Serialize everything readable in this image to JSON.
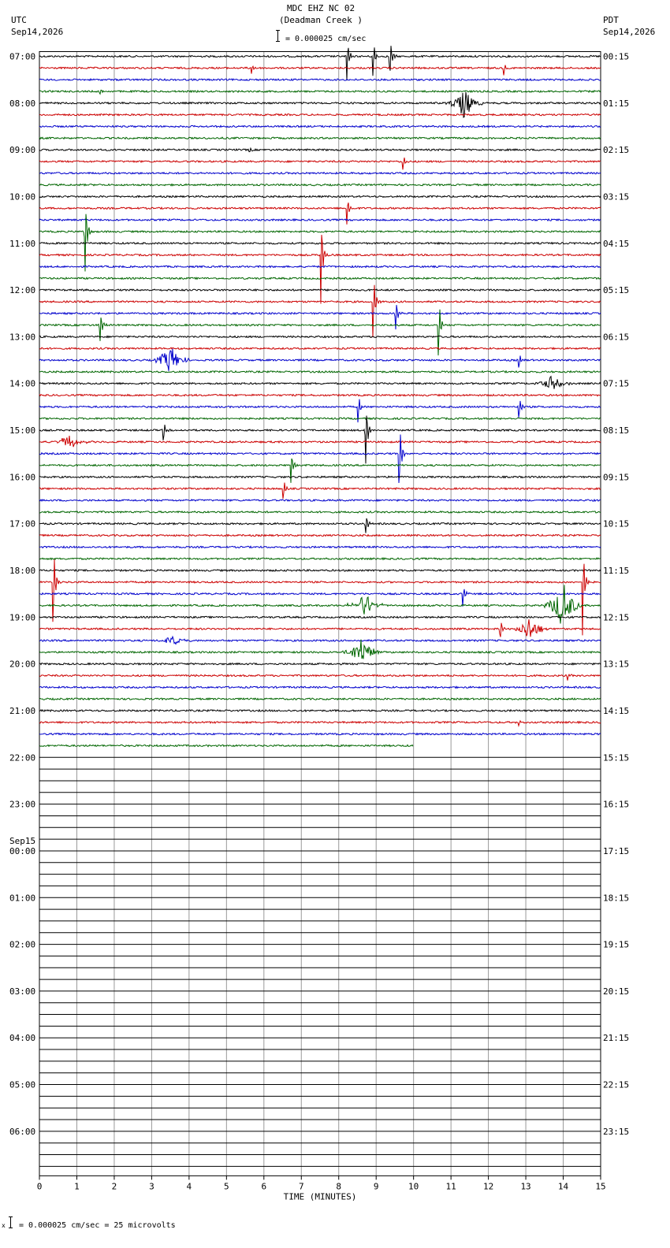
{
  "header": {
    "title": "MDC EHZ NC 02",
    "subtitle": "(Deadman Creek )",
    "scale_text": "= 0.000025 cm/sec",
    "left_tz": "UTC",
    "left_date": "Sep14,2026",
    "right_tz": "PDT",
    "right_date": "Sep14,2026"
  },
  "footer": {
    "scale_text": "= 0.000025 cm/sec =      25 microvolts",
    "scale_prefix": "x"
  },
  "chart_data": {
    "type": "line",
    "title": "MDC EHZ NC 02 (Deadman Creek )",
    "xlabel": "TIME (MINUTES)",
    "ylabel": "",
    "xlim": [
      0,
      15
    ],
    "x_ticks": [
      "0",
      "1",
      "2",
      "3",
      "4",
      "5",
      "6",
      "7",
      "8",
      "9",
      "10",
      "11",
      "12",
      "13",
      "14",
      "15"
    ],
    "trace_count": 96,
    "filled_traces": 60,
    "last_trace_end_minute": 10,
    "trace_colors": [
      "#000000",
      "#cc0000",
      "#0000cc",
      "#006600"
    ],
    "grid": true,
    "left_labels": [
      {
        "trace": 0,
        "text": "07:00"
      },
      {
        "trace": 4,
        "text": "08:00"
      },
      {
        "trace": 8,
        "text": "09:00"
      },
      {
        "trace": 12,
        "text": "10:00"
      },
      {
        "trace": 16,
        "text": "11:00"
      },
      {
        "trace": 20,
        "text": "12:00"
      },
      {
        "trace": 24,
        "text": "13:00"
      },
      {
        "trace": 28,
        "text": "14:00"
      },
      {
        "trace": 32,
        "text": "15:00"
      },
      {
        "trace": 36,
        "text": "16:00"
      },
      {
        "trace": 40,
        "text": "17:00"
      },
      {
        "trace": 44,
        "text": "18:00"
      },
      {
        "trace": 48,
        "text": "19:00"
      },
      {
        "trace": 52,
        "text": "20:00"
      },
      {
        "trace": 56,
        "text": "21:00"
      },
      {
        "trace": 60,
        "text": "22:00"
      },
      {
        "trace": 64,
        "text": "23:00"
      },
      {
        "trace": 68,
        "text": "00:00",
        "date": "Sep15"
      },
      {
        "trace": 72,
        "text": "01:00"
      },
      {
        "trace": 76,
        "text": "02:00"
      },
      {
        "trace": 80,
        "text": "03:00"
      },
      {
        "trace": 84,
        "text": "04:00"
      },
      {
        "trace": 88,
        "text": "05:00"
      },
      {
        "trace": 92,
        "text": "06:00"
      }
    ],
    "right_labels": [
      {
        "trace": 0,
        "text": "00:15"
      },
      {
        "trace": 4,
        "text": "01:15"
      },
      {
        "trace": 8,
        "text": "02:15"
      },
      {
        "trace": 12,
        "text": "03:15"
      },
      {
        "trace": 16,
        "text": "04:15"
      },
      {
        "trace": 20,
        "text": "05:15"
      },
      {
        "trace": 24,
        "text": "06:15"
      },
      {
        "trace": 28,
        "text": "07:15"
      },
      {
        "trace": 32,
        "text": "08:15"
      },
      {
        "trace": 36,
        "text": "09:15"
      },
      {
        "trace": 40,
        "text": "10:15"
      },
      {
        "trace": 44,
        "text": "11:15"
      },
      {
        "trace": 48,
        "text": "12:15"
      },
      {
        "trace": 52,
        "text": "13:15"
      },
      {
        "trace": 56,
        "text": "14:15"
      },
      {
        "trace": 60,
        "text": "15:15"
      },
      {
        "trace": 64,
        "text": "16:15"
      },
      {
        "trace": 68,
        "text": "17:15"
      },
      {
        "trace": 72,
        "text": "18:15"
      },
      {
        "trace": 76,
        "text": "19:15"
      },
      {
        "trace": 80,
        "text": "20:15"
      },
      {
        "trace": 84,
        "text": "21:15"
      },
      {
        "trace": 88,
        "text": "22:15"
      },
      {
        "trace": 92,
        "text": "23:15"
      }
    ],
    "events": [
      {
        "trace": 1,
        "minute": 5.65,
        "amp": 1.5,
        "type": "spike"
      },
      {
        "trace": 0,
        "minute": 8.2,
        "amp": 6,
        "type": "spike"
      },
      {
        "trace": 0,
        "minute": 8.9,
        "amp": 5,
        "type": "spike"
      },
      {
        "trace": 0,
        "minute": 9.35,
        "amp": 5.5,
        "type": "spike"
      },
      {
        "trace": 1,
        "minute": 12.4,
        "amp": 2,
        "type": "spike"
      },
      {
        "trace": 3,
        "minute": 1.6,
        "amp": 1,
        "type": "spike"
      },
      {
        "trace": 4,
        "minute": 11.35,
        "amp": 3,
        "type": "burst"
      },
      {
        "trace": 8,
        "minute": 5.6,
        "amp": 0.6,
        "type": "spike"
      },
      {
        "trace": 9,
        "minute": 9.7,
        "amp": 2,
        "type": "spike"
      },
      {
        "trace": 13,
        "minute": 8.2,
        "amp": 4,
        "type": "spike"
      },
      {
        "trace": 15,
        "minute": 1.2,
        "amp": 12,
        "type": "spike"
      },
      {
        "trace": 17,
        "minute": 7.5,
        "amp": 14,
        "type": "spike"
      },
      {
        "trace": 21,
        "minute": 8.9,
        "amp": 9,
        "type": "spike"
      },
      {
        "trace": 22,
        "minute": 9.5,
        "amp": 5,
        "type": "spike"
      },
      {
        "trace": 23,
        "minute": 1.6,
        "amp": 5,
        "type": "spike"
      },
      {
        "trace": 23,
        "minute": 10.65,
        "amp": 8,
        "type": "spike"
      },
      {
        "trace": 26,
        "minute": 3.5,
        "amp": 3,
        "type": "burst"
      },
      {
        "trace": 26,
        "minute": 12.8,
        "amp": 2,
        "type": "spike"
      },
      {
        "trace": 28,
        "minute": 13.7,
        "amp": 1.5,
        "type": "burst"
      },
      {
        "trace": 30,
        "minute": 8.5,
        "amp": 4,
        "type": "spike"
      },
      {
        "trace": 30,
        "minute": 12.8,
        "amp": 3,
        "type": "spike"
      },
      {
        "trace": 32,
        "minute": 3.3,
        "amp": 3,
        "type": "spike"
      },
      {
        "trace": 33,
        "minute": 0.8,
        "amp": 1.5,
        "type": "burst"
      },
      {
        "trace": 32,
        "minute": 8.7,
        "amp": 10,
        "type": "spike"
      },
      {
        "trace": 34,
        "minute": 9.6,
        "amp": 10,
        "type": "spike"
      },
      {
        "trace": 35,
        "minute": 6.7,
        "amp": 5,
        "type": "spike"
      },
      {
        "trace": 37,
        "minute": 6.5,
        "amp": 3,
        "type": "spike"
      },
      {
        "trace": 40,
        "minute": 8.7,
        "amp": 3,
        "type": "spike"
      },
      {
        "trace": 45,
        "minute": 0.35,
        "amp": 12,
        "type": "spike"
      },
      {
        "trace": 45,
        "minute": 14.5,
        "amp": 13,
        "type": "spike"
      },
      {
        "trace": 46,
        "minute": 11.3,
        "amp": 3,
        "type": "spike"
      },
      {
        "trace": 47,
        "minute": 8.7,
        "amp": 2.5,
        "type": "burst"
      },
      {
        "trace": 47,
        "minute": 14.0,
        "amp": 5,
        "type": "burst"
      },
      {
        "trace": 49,
        "minute": 12.3,
        "amp": 3,
        "type": "spike"
      },
      {
        "trace": 49,
        "minute": 13.1,
        "amp": 2.5,
        "type": "burst"
      },
      {
        "trace": 50,
        "minute": 3.6,
        "amp": 1,
        "type": "burst"
      },
      {
        "trace": 51,
        "minute": 8.6,
        "amp": 3,
        "type": "burst"
      },
      {
        "trace": 53,
        "minute": 14.1,
        "amp": 1,
        "type": "spike"
      },
      {
        "trace": 57,
        "minute": 12.8,
        "amp": 1,
        "type": "spike"
      }
    ]
  }
}
